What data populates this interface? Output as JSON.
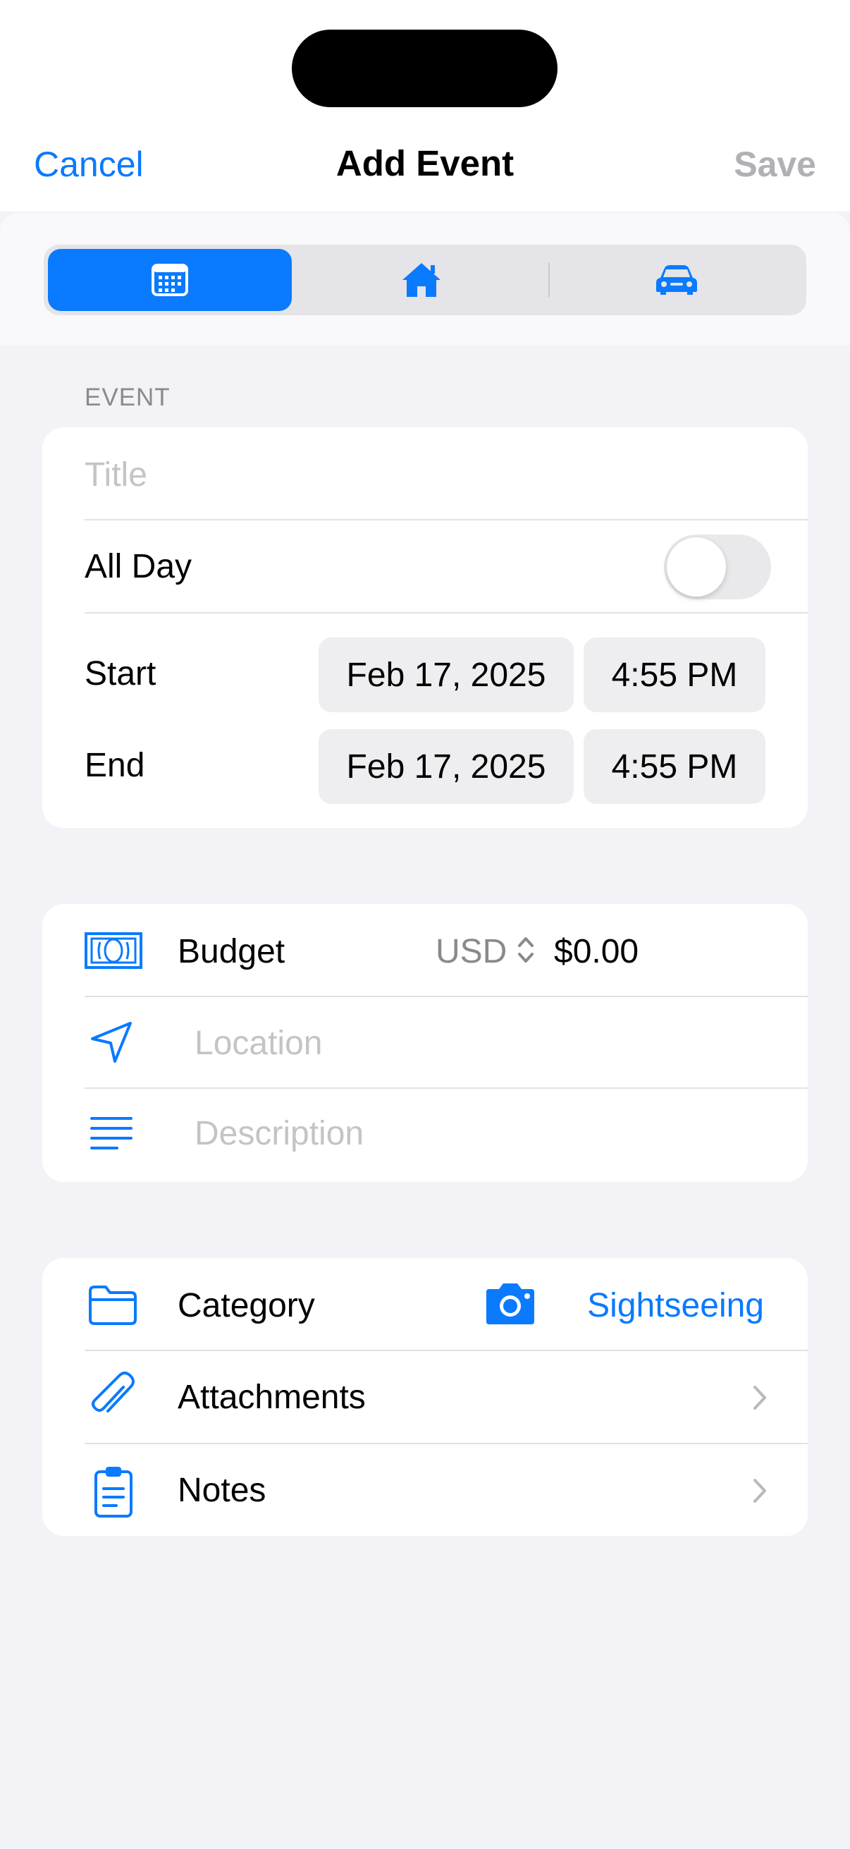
{
  "nav": {
    "cancel_label": "Cancel",
    "title": "Add Event",
    "save_label": "Save"
  },
  "segments": [
    {
      "icon": "calendar-icon",
      "active": true
    },
    {
      "icon": "house-icon",
      "active": false
    },
    {
      "icon": "car-icon",
      "active": false
    }
  ],
  "event_section": {
    "header": "EVENT",
    "title_placeholder": "Title",
    "all_day_label": "All Day",
    "all_day_on": false,
    "start_label": "Start",
    "start_date": "Feb 17, 2025",
    "start_time": "4:55 PM",
    "end_label": "End",
    "end_date": "Feb 17, 2025",
    "end_time": "4:55 PM"
  },
  "details_section": {
    "budget_label": "Budget",
    "currency": "USD",
    "amount": "$0.00",
    "location_placeholder": "Location",
    "description_placeholder": "Description"
  },
  "meta_section": {
    "category_label": "Category",
    "category_value": "Sightseeing",
    "attachments_label": "Attachments",
    "notes_label": "Notes"
  },
  "colors": {
    "accent": "#0a7aff",
    "background": "#f2f2f7",
    "disabled": "#b0b0b5"
  }
}
